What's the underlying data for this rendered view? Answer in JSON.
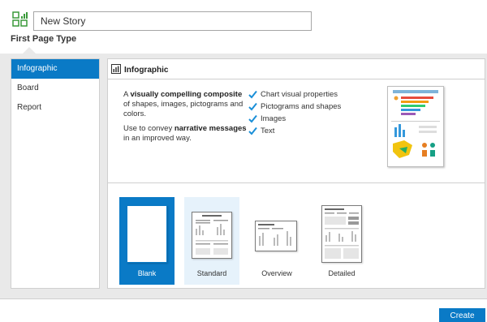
{
  "header": {
    "story_name": "New Story",
    "section_title": "First Page Type",
    "app_icon": "story-chart-icon"
  },
  "sidebar": {
    "items": [
      {
        "label": "Infographic",
        "active": true
      },
      {
        "label": "Board",
        "active": false
      },
      {
        "label": "Report",
        "active": false
      }
    ]
  },
  "type_panel": {
    "title": "Infographic",
    "title_icon": "infographic-icon",
    "description": {
      "line1_prefix": "A ",
      "line1_bold": "visually compelling composite",
      "line1_rest": " of shapes, images, pictograms and colors.",
      "line2_prefix": "Use to convey ",
      "line2_bold": "narrative messages",
      "line2_rest": " in an improved way."
    },
    "features": [
      "Chart visual properties",
      "Pictograms and shapes",
      "Images",
      "Text"
    ]
  },
  "templates": [
    {
      "label": "Blank",
      "state": "selected"
    },
    {
      "label": "Standard",
      "state": "hover"
    },
    {
      "label": "Overview",
      "state": "normal"
    },
    {
      "label": "Detailed",
      "state": "normal"
    }
  ],
  "footer": {
    "create_label": "Create"
  },
  "colors": {
    "accent": "#0a7ac6",
    "panel_bg": "#e9e9e9",
    "hover_bg": "#e6f2fb",
    "check": "#1a8fd8"
  }
}
